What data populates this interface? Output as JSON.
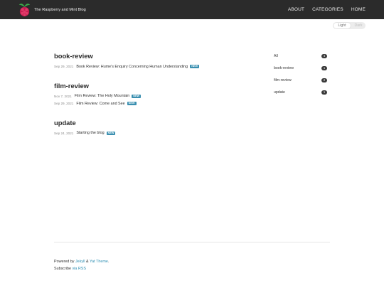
{
  "header": {
    "site_title": "The Raspberry and Mint Blog",
    "nav": [
      "ABOUT",
      "CATEGORIES",
      "HOME"
    ]
  },
  "theme_toggle": {
    "light": "Light",
    "dark": "Dark",
    "active": "Light"
  },
  "categories": [
    {
      "title": "book-review",
      "posts": [
        {
          "date": "Sep 29, 2021",
          "title": "Book Review: Hume's Enquiry Concerning Human Understanding",
          "badge": "NEW"
        }
      ]
    },
    {
      "title": "film-review",
      "posts": [
        {
          "date": "Nov 7, 2021",
          "title": "Film Review: The Holy Mountain",
          "badge": "NEW"
        },
        {
          "date": "Sep 29, 2021",
          "title": "Film Review: Come and See",
          "badge": "NEW"
        }
      ]
    },
    {
      "title": "update",
      "posts": [
        {
          "date": "Sep 24, 2021",
          "title": "Starting the blog",
          "badge": "NEW"
        }
      ]
    }
  ],
  "sidebar": [
    {
      "label": "All",
      "count": "4"
    },
    {
      "label": "book-review",
      "count": "1"
    },
    {
      "label": "film-review",
      "count": "2"
    },
    {
      "label": "update",
      "count": "1"
    }
  ],
  "footer": {
    "powered_prefix": "Powered by ",
    "jekyll": "Jekyll",
    "amp": " & ",
    "theme": "Yat Theme",
    "period": ".",
    "subscribe_prefix": "Subscribe ",
    "rss": "via RSS"
  },
  "colors": {
    "navbar": "#2b2b2b",
    "link": "#2e8fb3",
    "badge": "#3a8fb0",
    "count_pill": "#3a3a3a"
  },
  "icons": {
    "logo": "raspberry-logo-icon"
  }
}
